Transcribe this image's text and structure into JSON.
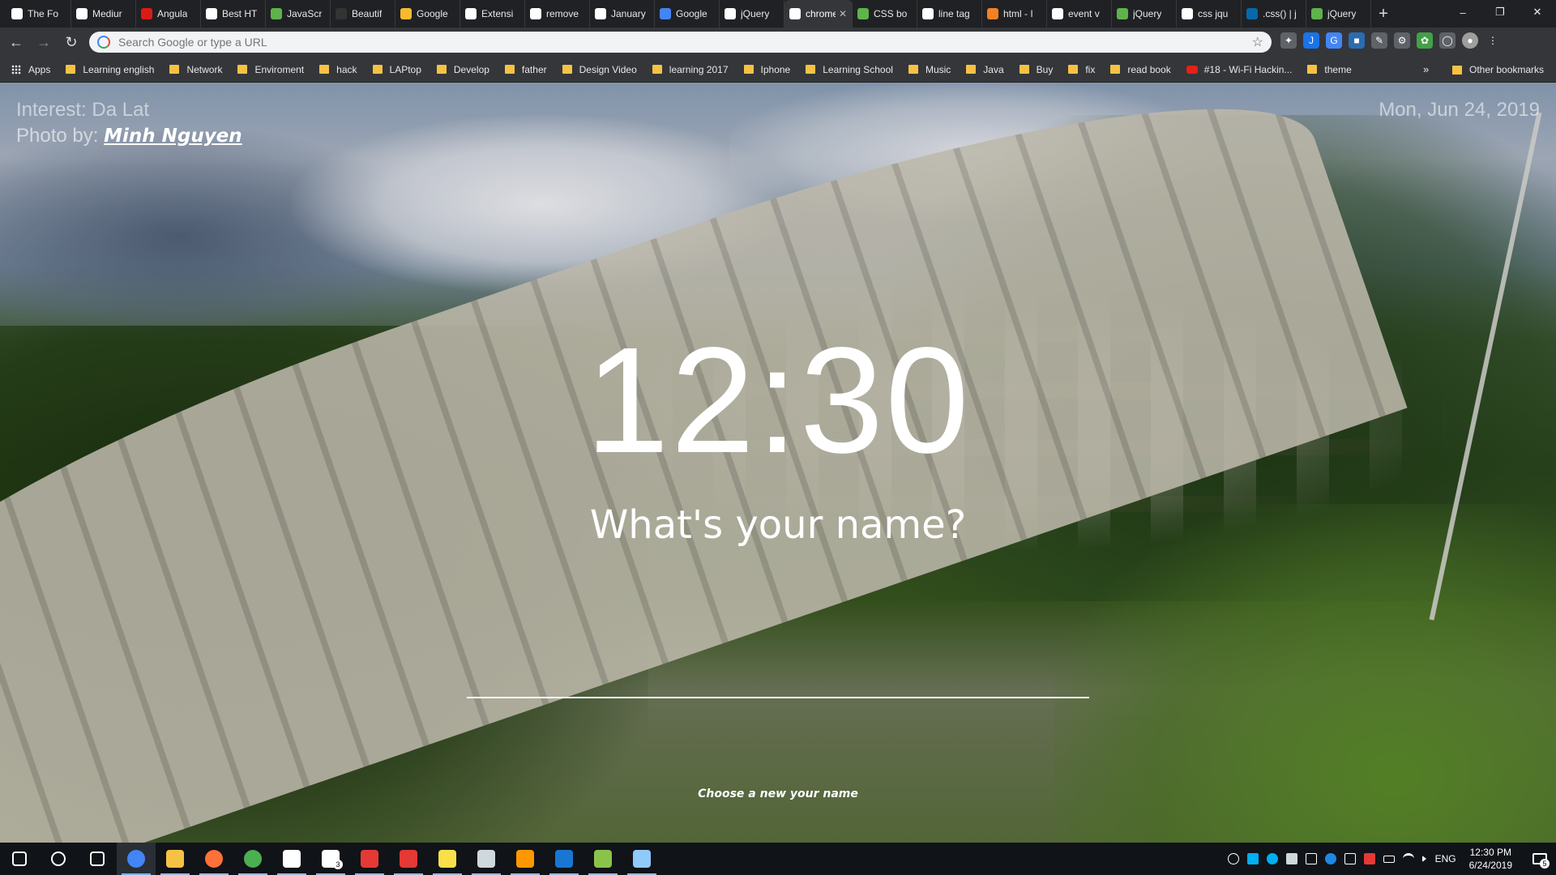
{
  "browser": {
    "tabs": [
      {
        "label": "The Fo",
        "icon": "document-icon",
        "color": "#ffffff"
      },
      {
        "label": "Mediur",
        "icon": "medium-icon",
        "color": "#ffffff"
      },
      {
        "label": "Angula",
        "icon": "angular-icon",
        "color": "#dd1b16"
      },
      {
        "label": "Best HT",
        "icon": "medium-icon",
        "color": "#ffffff"
      },
      {
        "label": "JavaScr",
        "icon": "stackoverflow-icon",
        "color": "#5eb34a"
      },
      {
        "label": "Beautif",
        "icon": "folder-icon",
        "color": "#333333"
      },
      {
        "label": "Google",
        "icon": "google-keep-icon",
        "color": "#f9bb2d"
      },
      {
        "label": "Extensi",
        "icon": "puzzle-icon",
        "color": "#ffffff"
      },
      {
        "label": "remove",
        "icon": "google-icon",
        "color": "#ffffff"
      },
      {
        "label": "January",
        "icon": "wikipedia-icon",
        "color": "#ffffff"
      },
      {
        "label": "Google",
        "icon": "google-translate-icon",
        "color": "#4285f4"
      },
      {
        "label": "jQuery",
        "icon": "jquery-icon",
        "color": "#ffffff"
      },
      {
        "label": "chrome",
        "icon": "chrome-icon",
        "color": "#ffffff",
        "active": true
      },
      {
        "label": "CSS bo",
        "icon": "stackoverflow-icon",
        "color": "#5eb34a"
      },
      {
        "label": "line tag",
        "icon": "google-icon",
        "color": "#ffffff"
      },
      {
        "label": "html - I",
        "icon": "stackoverflow-icon",
        "color": "#f48024"
      },
      {
        "label": "event v",
        "icon": "google-icon",
        "color": "#ffffff"
      },
      {
        "label": "jQuery",
        "icon": "stackoverflow-icon",
        "color": "#5eb34a"
      },
      {
        "label": "css jqu",
        "icon": "google-icon",
        "color": "#ffffff"
      },
      {
        "label": ".css() | j",
        "icon": "jquery-icon",
        "color": "#0868ac"
      },
      {
        "label": "jQuery",
        "icon": "stackoverflow-icon",
        "color": "#5eb34a"
      }
    ],
    "close_glyph": "✕",
    "new_tab_glyph": "+",
    "omnibox": {
      "placeholder": "Search Google or type a URL"
    },
    "window_controls": {
      "minimize": "–",
      "restore": "❐",
      "close": "✕"
    }
  },
  "bookmarks": {
    "items": [
      {
        "label": "Apps",
        "kind": "apps"
      },
      {
        "label": "Learning english",
        "kind": "folder"
      },
      {
        "label": "Network",
        "kind": "folder"
      },
      {
        "label": "Enviroment",
        "kind": "folder"
      },
      {
        "label": "hack",
        "kind": "folder"
      },
      {
        "label": "LAPtop",
        "kind": "folder"
      },
      {
        "label": "Develop",
        "kind": "folder"
      },
      {
        "label": "father",
        "kind": "folder"
      },
      {
        "label": "Design Video",
        "kind": "folder"
      },
      {
        "label": "learning 2017",
        "kind": "folder"
      },
      {
        "label": "Iphone",
        "kind": "folder"
      },
      {
        "label": "Learning School",
        "kind": "folder"
      },
      {
        "label": "Music",
        "kind": "folder"
      },
      {
        "label": "Java",
        "kind": "folder"
      },
      {
        "label": "Buy",
        "kind": "folder"
      },
      {
        "label": "fix",
        "kind": "folder"
      },
      {
        "label": "read book",
        "kind": "folder"
      },
      {
        "label": "#18 - Wi-Fi Hackin...",
        "kind": "youtube"
      },
      {
        "label": "theme",
        "kind": "folder"
      }
    ],
    "more": "»",
    "other": "Other bookmarks"
  },
  "page": {
    "interest": "Interest: Da Lat",
    "photo_by_label": "Photo by: ",
    "photographer": "Minh Nguyen",
    "date": "Mon, Jun 24, 2019",
    "clock": "12:30",
    "question": "What's your name?",
    "name_input_value": "",
    "choose_link": "Choose a new your name"
  },
  "taskbar": {
    "apps": [
      {
        "icon": "windows-start-icon",
        "color": "#ffffff"
      },
      {
        "icon": "search-icon",
        "color": "#ffffff"
      },
      {
        "icon": "task-view-icon",
        "color": "#ffffff"
      },
      {
        "icon": "chrome-icon",
        "color": "#4285f4",
        "active": true
      },
      {
        "icon": "file-explorer-icon",
        "color": "#f6c244"
      },
      {
        "icon": "firefox-icon",
        "color": "#ff7139"
      },
      {
        "icon": "green-app-icon",
        "color": "#4caf50"
      },
      {
        "icon": "store-icon",
        "color": "#ffffff"
      },
      {
        "icon": "mail-icon",
        "color": "#ffffff",
        "badge": "3"
      },
      {
        "icon": "red-app-icon",
        "color": "#e53935"
      },
      {
        "icon": "red-bird-icon",
        "color": "#e53935"
      },
      {
        "icon": "sticky-notes-icon",
        "color": "#f9e04b"
      },
      {
        "icon": "app-icon",
        "color": "#cfd8dc"
      },
      {
        "icon": "sublime-text-icon",
        "color": "#ff9800"
      },
      {
        "icon": "css3-icon",
        "color": "#1976d2"
      },
      {
        "icon": "git-icon",
        "color": "#8bc34a"
      },
      {
        "icon": "paint-icon",
        "color": "#90caf9"
      }
    ],
    "tray": {
      "language": "ENG",
      "time": "12:30 PM",
      "date": "6/24/2019",
      "notification_count": "5"
    }
  }
}
